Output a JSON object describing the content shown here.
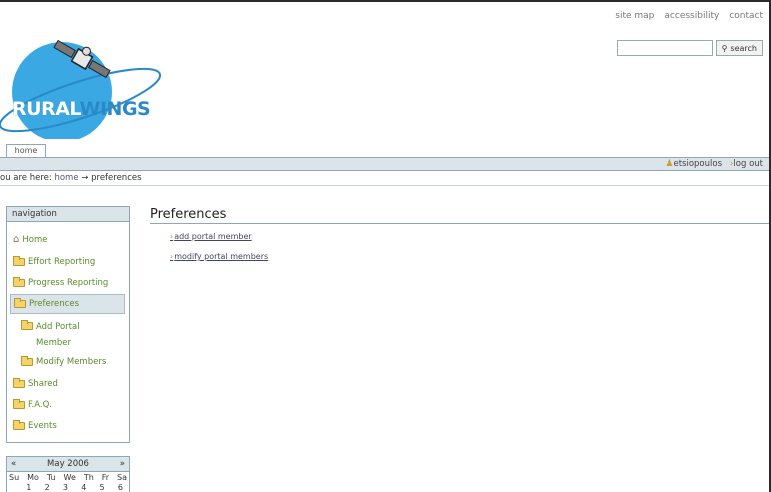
{
  "site_actions": [
    "site map",
    "accessibility",
    "contact"
  ],
  "search": {
    "button_label": "search"
  },
  "logo": {
    "part1": "RURAL",
    "part2": "WINGS"
  },
  "tabs": {
    "home": "home"
  },
  "personal_bar": {
    "user": "etsiopoulos",
    "logout": "log out"
  },
  "breadcrumb": {
    "prefix": "ou are here:",
    "home": "home",
    "arrow": "→",
    "current": "preferences"
  },
  "navigation": {
    "header": "navigation",
    "items": [
      {
        "label": "Home"
      },
      {
        "label": "Effort Reporting"
      },
      {
        "label": "Progress Reporting"
      },
      {
        "label": "Preferences"
      },
      {
        "label": "Add Portal Member"
      },
      {
        "label": "Modify Members"
      },
      {
        "label": "Shared"
      },
      {
        "label": "F.A.Q."
      },
      {
        "label": "Events"
      }
    ]
  },
  "calendar": {
    "prev": "«",
    "title": "May 2006",
    "next": "»",
    "days": [
      "Su",
      "Mo",
      "Tu",
      "We",
      "Th",
      "Fr",
      "Sa"
    ],
    "first_row": [
      "",
      "1",
      "2",
      "3",
      "4",
      "5",
      "6"
    ]
  },
  "content": {
    "title": "Preferences",
    "links": [
      "add portal member",
      "modify portal members"
    ]
  },
  "colors": {
    "accent": "#2a8ac8",
    "bar": "#dbe4e8",
    "nav_text": "#5a8a2a"
  }
}
